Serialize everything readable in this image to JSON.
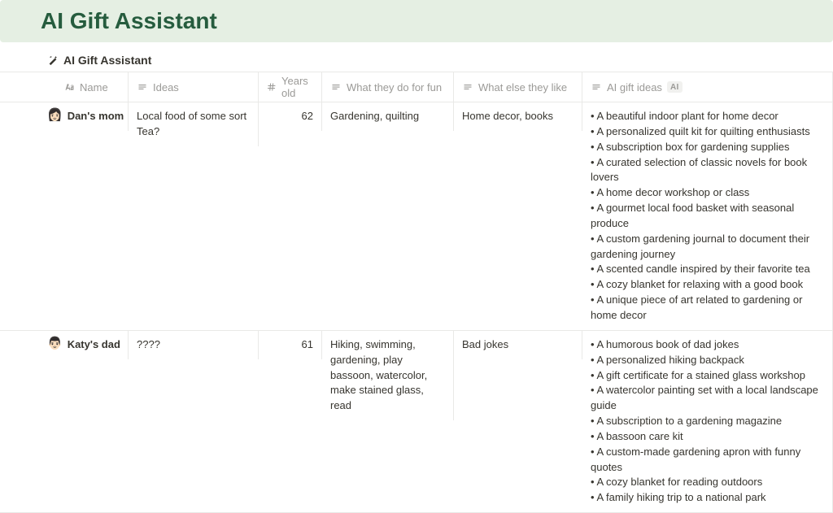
{
  "page": {
    "title": "AI Gift Assistant",
    "db_label": "AI Gift Assistant"
  },
  "columns": {
    "name": "Name",
    "ideas": "Ideas",
    "years": "Years old",
    "fun": "What they do for fun",
    "like": "What else they like",
    "ai": "AI gift ideas",
    "ai_badge": "AI"
  },
  "rows": [
    {
      "avatar": "👩🏻",
      "name": "Dan's mom",
      "ideas": "Local food of some sort\nTea?",
      "years": "62",
      "fun": "Gardening, quilting",
      "like": "Home decor, books",
      "ai": "• A beautiful indoor plant for home decor\n• A personalized quilt kit for quilting enthusiasts\n• A subscription box for gardening supplies\n• A curated selection of classic novels for book lovers\n• A home decor workshop or class\n• A gourmet local food basket with seasonal produce\n• A custom gardening journal to document their gardening journey\n• A scented candle inspired by their favorite tea\n• A cozy blanket for relaxing with a good book\n• A unique piece of art related to gardening or home decor"
    },
    {
      "avatar": "👨🏻",
      "name": "Katy's dad",
      "ideas": "????",
      "years": "61",
      "fun": "Hiking, swimming, gardening, play bassoon, watercolor, make stained glass, read",
      "like": "Bad jokes",
      "ai": "• A humorous book of dad jokes\n• A personalized hiking backpack\n• A gift certificate for a stained glass workshop\n• A watercolor painting set with a local landscape guide\n• A subscription to a gardening magazine\n• A bassoon care kit\n• A custom-made gardening apron with funny quotes\n• A cozy blanket for reading outdoors\n• A family hiking trip to a national park"
    }
  ]
}
